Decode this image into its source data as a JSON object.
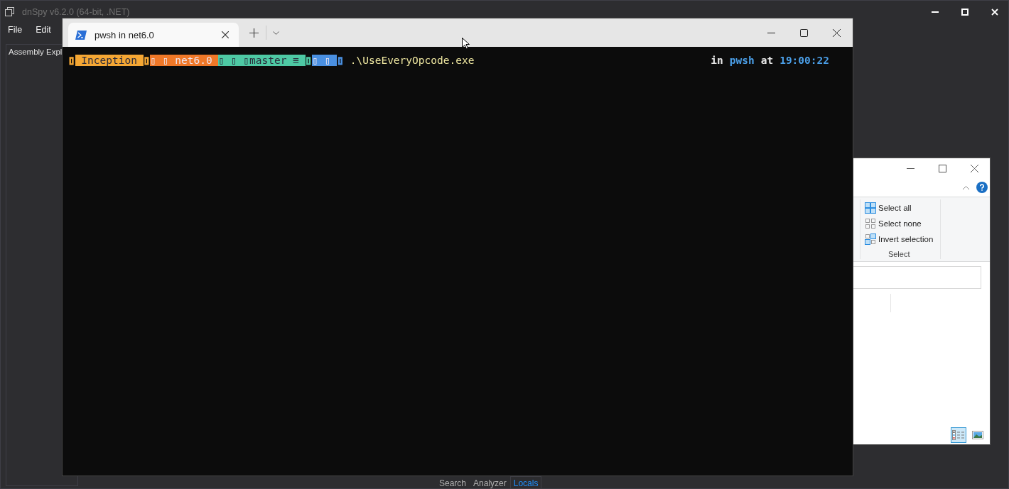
{
  "dnspy": {
    "title": "dnSpy v6.2.0 (64-bit, .NET)",
    "menu": [
      "File",
      "Edit"
    ],
    "panel_title": "Assembly Expl",
    "bottom_tabs": [
      {
        "label": "Search",
        "selected": false
      },
      {
        "label": "Analyzer",
        "selected": false
      },
      {
        "label": "Locals",
        "selected": true
      }
    ]
  },
  "terminal": {
    "tab_title": "pwsh in net6.0",
    "segments": [
      {
        "kind": "cap",
        "text": "▯",
        "color": "#f5a734"
      },
      {
        "kind": "block",
        "text": " Inception ",
        "color": "#f5a734",
        "light_text": false
      },
      {
        "kind": "cap",
        "text": "▯",
        "color": "#f5a734"
      },
      {
        "kind": "block",
        "text": "▯ ▯ net6.0 ",
        "color": "#f07828",
        "light_text": true
      },
      {
        "kind": "block",
        "text": "▯ ▯ ▯master ≡ ",
        "color": "#4ec9a4",
        "light_text": false
      },
      {
        "kind": "cap",
        "text": "▯",
        "color": "#4ec9a4"
      },
      {
        "kind": "block",
        "text": "▯ ▯ ",
        "color": "#4a90e2",
        "light_text": true
      },
      {
        "kind": "cap",
        "text": "▯",
        "color": "#4a90e2"
      }
    ],
    "command": ".\\UseEveryOpcode.exe",
    "right": [
      {
        "kind": "plain",
        "text": "in"
      },
      {
        "kind": "accent",
        "text": "pwsh"
      },
      {
        "kind": "plain",
        "text": "at"
      },
      {
        "kind": "accent",
        "text": "19:00:22"
      }
    ]
  },
  "explorer": {
    "actions": [
      {
        "kind": "all",
        "label": "Select all"
      },
      {
        "kind": "none",
        "label": "Select none"
      },
      {
        "kind": "invert",
        "label": "Invert selection"
      }
    ],
    "group": "Select",
    "views": [
      {
        "kind": "details",
        "selected": true
      },
      {
        "kind": "thumbnails",
        "selected": false
      }
    ]
  }
}
